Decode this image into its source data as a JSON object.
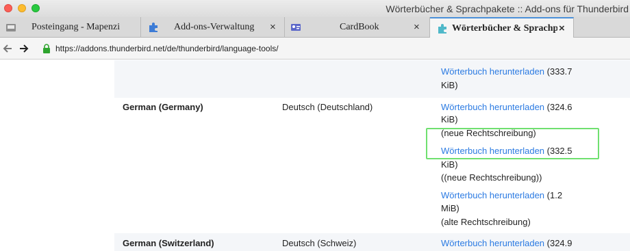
{
  "window": {
    "title": "Wörterbücher & Sprachpakete :: Add-ons für Thunderbird"
  },
  "tabs": [
    {
      "label": "Posteingang - Mapenzi",
      "icon": "inbox-icon"
    },
    {
      "label": "Add-ons-Verwaltung",
      "icon": "puzzle-icon",
      "close": "×"
    },
    {
      "label": "CardBook",
      "icon": "address-card-icon",
      "close": "×"
    },
    {
      "label": "Wörterbücher & Sprachpakete",
      "icon": "puzzle-icon",
      "close": "×"
    }
  ],
  "nav": {
    "url": "https://addons.thunderbird.net/de/thunderbird/language-tools/"
  },
  "rows": {
    "prev": {
      "link": "Wörterbuch herunterladen",
      "size1": " (333.7",
      "size2": "KiB)"
    },
    "germany": {
      "language": "German (Germany)",
      "native": "Deutsch (Deutschland)",
      "d1": {
        "link": "Wörterbuch herunterladen",
        "size1": " (324.6",
        "size2": "KiB)",
        "note": "(neue Rechtschreibung)"
      },
      "d2": {
        "link": "Wörterbuch herunterladen",
        "size1": " (332.5",
        "size2": "KiB)",
        "note": "((neue Rechtschreibung))"
      },
      "d3": {
        "link": "Wörterbuch herunterladen",
        "size1": " (1.2",
        "size2": "MiB)",
        "note": "(alte Rechtschreibung)"
      }
    },
    "switzerland": {
      "language": "German (Switzerland)",
      "native": "Deutsch (Schweiz)",
      "link": "Wörterbuch herunterladen",
      "size1": " (324.9"
    }
  },
  "colors": {
    "link": "#2a7ae2",
    "highlight": "#6fe06f",
    "active_tab_accent": "#4a90d9"
  }
}
